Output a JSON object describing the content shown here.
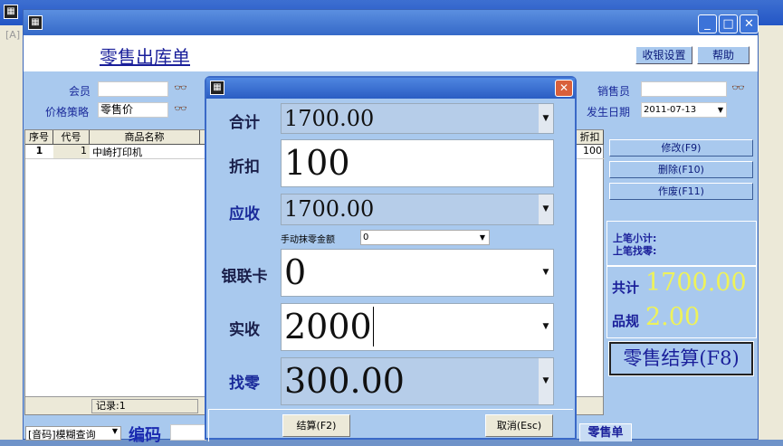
{
  "outer": {
    "tab_label": "[A]"
  },
  "window": {
    "title": "零售出库单",
    "buttons": {
      "cashier_settings": "收银设置",
      "help": "帮助"
    }
  },
  "form": {
    "member_label": "会员",
    "member_value": "",
    "price_policy_label": "价格策略",
    "price_policy_value": "零售价",
    "salesperson_label": "销售员",
    "salesperson_value": "",
    "date_label": "发生日期",
    "date_value": "2011-07-13"
  },
  "grid": {
    "columns": [
      "序号",
      "代号",
      "商品名称"
    ],
    "discount_col": "折扣",
    "rows": [
      {
        "seq": "1",
        "code": "1",
        "name": "中崎打印机",
        "discount": "100"
      }
    ],
    "record_label": "记录:1"
  },
  "actions": {
    "edit": "修改(F9)",
    "delete": "删除(F10)",
    "void": "作废(F11)",
    "checkout": "零售结算(F8)"
  },
  "summary": {
    "last_subtotal_label": "上笔小计:",
    "last_change_label": "上笔找零:",
    "total_label": "共计",
    "total_value": "1700.00",
    "items_label": "品规",
    "items_value": "2.00"
  },
  "bottom": {
    "search_mode": "[音码]模糊查询",
    "code_label": "编码",
    "code_value": "",
    "tab": "零售单"
  },
  "dialog": {
    "total_label": "合计",
    "total_value": "1700.00",
    "discount_label": "折扣",
    "discount_value": "100",
    "receivable_label": "应收",
    "receivable_value": "1700.00",
    "rounding_label": "手动抹零金额",
    "rounding_value": "0",
    "card_label": "银联卡",
    "card_value": "0",
    "received_label": "实收",
    "received_value": "2000",
    "change_label": "找零",
    "change_value": "300.00",
    "settle_button": "结算(F2)",
    "cancel_button": "取消(Esc)"
  }
}
